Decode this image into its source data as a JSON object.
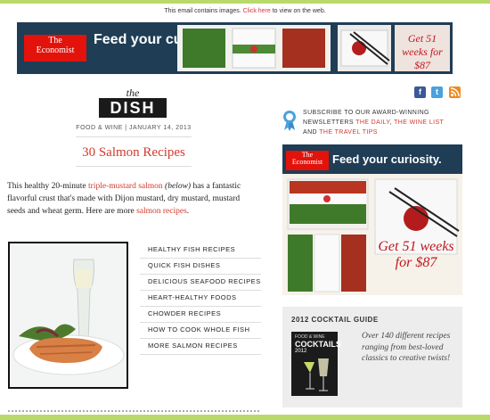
{
  "notice": {
    "text": "This email contains images.",
    "link": "Click here",
    "rest": "to view on the web."
  },
  "ad_top": {
    "brand_line1": "The",
    "brand_line2": "Economist",
    "tagline": "Feed your curiosity.",
    "promo": "Get 51 weeks for $87"
  },
  "masthead": {
    "the": "the",
    "dish": "DISH",
    "byline": "FOOD & WINE | JANUARY 14, 2013"
  },
  "article": {
    "headline": "30 Salmon Recipes",
    "intro_1": "This healthy 20-minute ",
    "intro_link": "triple-mustard salmon",
    "intro_2": " (below)",
    "intro_3": " has a fantastic flavorful crust that's made with Dijon mustard, dry mustard, mustard seeds and wheat germ. Here are more ",
    "intro_link2": "salmon recipes",
    "intro_end": "."
  },
  "recipe_links": [
    "HEALTHY FISH RECIPES",
    "QUICK FISH DISHES",
    "DELICIOUS SEAFOOD RECIPES",
    "HEART-HEALTHY FOODS",
    "CHOWDER RECIPES",
    "HOW TO COOK WHOLE FISH",
    "MORE SALMON RECIPES"
  ],
  "social": {
    "facebook_icon": "f",
    "twitter_icon": "t",
    "rss_icon": "rss"
  },
  "subscribe": {
    "text": "SUBSCRIBE TO OUR AWARD-WINNING NEWSLETTERS",
    "link1": "THE DAILY",
    "sep": ",",
    "link2": "THE WINE LIST",
    "and": "AND",
    "link3": "THE TRAVEL TIPS"
  },
  "ad_side": {
    "brand_line1": "The",
    "brand_line2": "Economist",
    "tagline": "Feed your curiosity.",
    "promo": "Get 51 weeks for $87"
  },
  "cocktail": {
    "title": "2012 COCKTAIL GUIDE",
    "book_line1": "FOOD & WINE",
    "book_line2": "COCKTAILS",
    "book_line3": "2012",
    "description": "Over 140 different recipes ranging from best-loved classics to creative twists!"
  },
  "colors": {
    "accent_red": "#d33a2c",
    "frame_green": "#b9d96b",
    "economist_navy": "#1f3d55",
    "economist_red": "#e3120b"
  }
}
